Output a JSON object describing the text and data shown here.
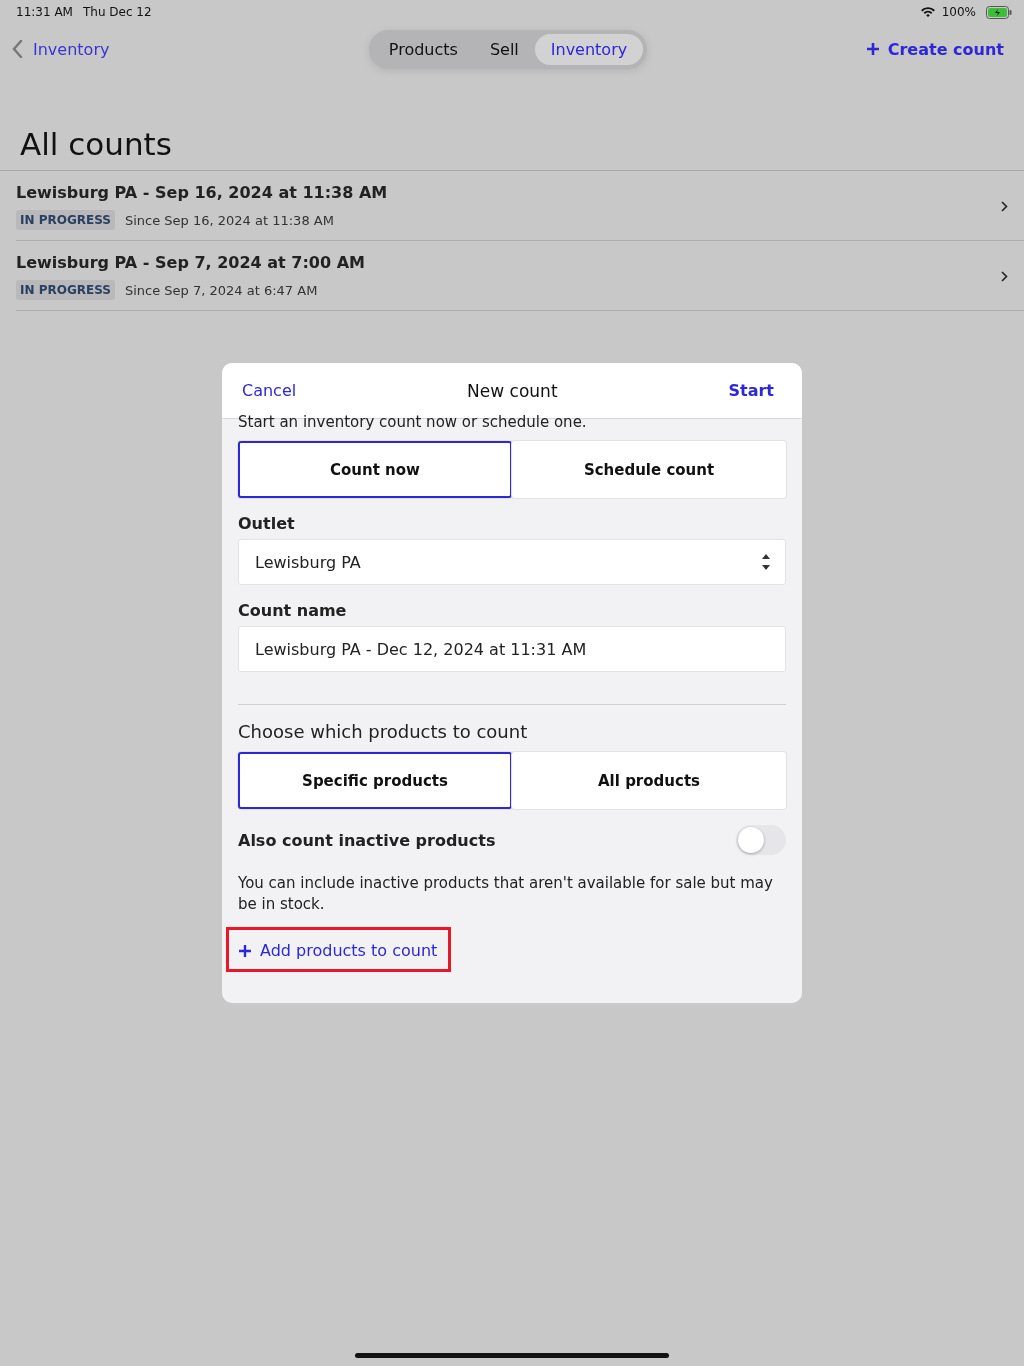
{
  "status_bar": {
    "time": "11:31 AM",
    "date": "Thu Dec 12",
    "battery": "100%"
  },
  "nav": {
    "back": "Inventory",
    "action": "Create count"
  },
  "segments": [
    {
      "label": "Products",
      "selected": false
    },
    {
      "label": "Sell",
      "selected": false
    },
    {
      "label": "Inventory",
      "selected": true
    }
  ],
  "title": "All counts",
  "counts": [
    {
      "name": "Lewisburg PA - Sep 16, 2024 at 11:38 AM",
      "status": "IN PROGRESS",
      "since": "Since Sep 16, 2024 at 11:38 AM"
    },
    {
      "name": "Lewisburg PA - Sep 7, 2024 at 7:00 AM",
      "status": "IN PROGRESS",
      "since": "Since Sep 7, 2024 at 6:47 AM"
    }
  ],
  "modal": {
    "cancel": "Cancel",
    "title": "New count",
    "start": "Start",
    "intro": "Start an inventory count now or schedule one.",
    "timing": [
      {
        "label": "Count now",
        "selected": true
      },
      {
        "label": "Schedule count",
        "selected": false
      }
    ],
    "outlet_label": "Outlet",
    "outlet": "Lewisburg PA",
    "name_label": "Count name",
    "name_value": "Lewisburg PA - Dec 12, 2024 at 11:31 AM",
    "products_heading": "Choose which products to count",
    "scope": [
      {
        "label": "Specific products",
        "selected": true
      },
      {
        "label": "All products",
        "selected": false
      }
    ],
    "inactive_label": "Also count inactive products",
    "inactive_on": false,
    "inactive_help": "You can include inactive products that aren't available for sale but may be in stock.",
    "add_products": "Add products to count",
    "add_highlighted": true
  }
}
